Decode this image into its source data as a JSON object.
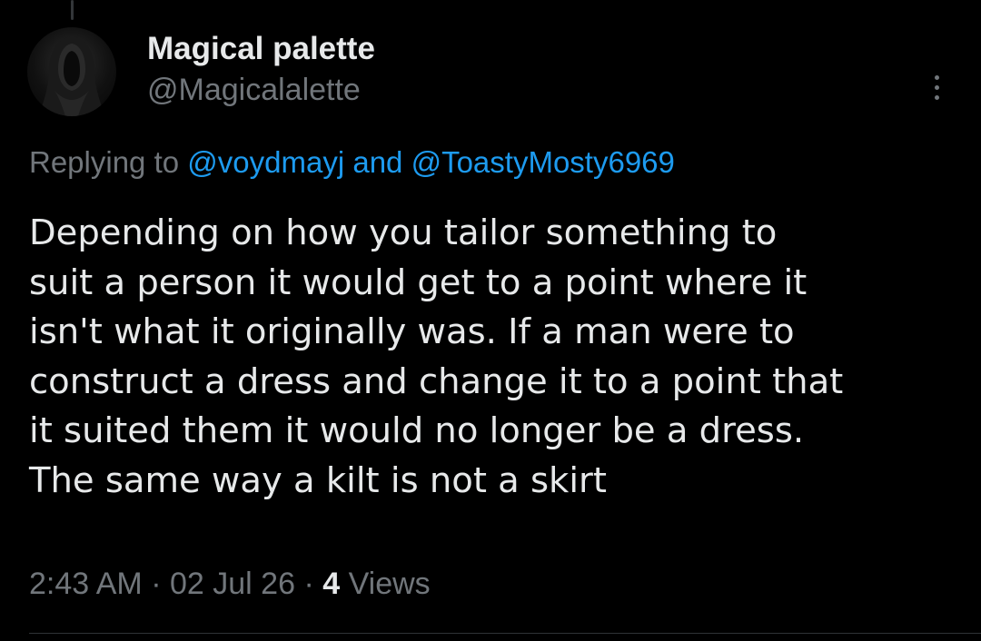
{
  "author": {
    "display_name": "Magical palette",
    "handle": "@Magicalalette",
    "avatar_icon": "hooded-figure-avatar"
  },
  "reply": {
    "prefix": "Replying to",
    "mention_1": "@voydmayj",
    "joiner": "and",
    "mention_2": "@ToastyMosty6969"
  },
  "tweet": {
    "text": "Depending on how you tailor something to\nsuit a person it would get to a point where it\nisn't what it originally was. If a man were to\nconstruct a dress and change it to a point that\nit suited them it would no longer be a dress.\nThe same way a kilt is not a skirt"
  },
  "meta": {
    "time": "2:43 AM",
    "separator": "·",
    "date": "02 Jul 26",
    "views_count": "4",
    "views_label": "Views"
  },
  "colors": {
    "background": "#000000",
    "text": "#e7e9ea",
    "secondary": "#71767b",
    "link": "#1d9bf0"
  },
  "icons": {
    "more": "more-vertical-icon"
  }
}
